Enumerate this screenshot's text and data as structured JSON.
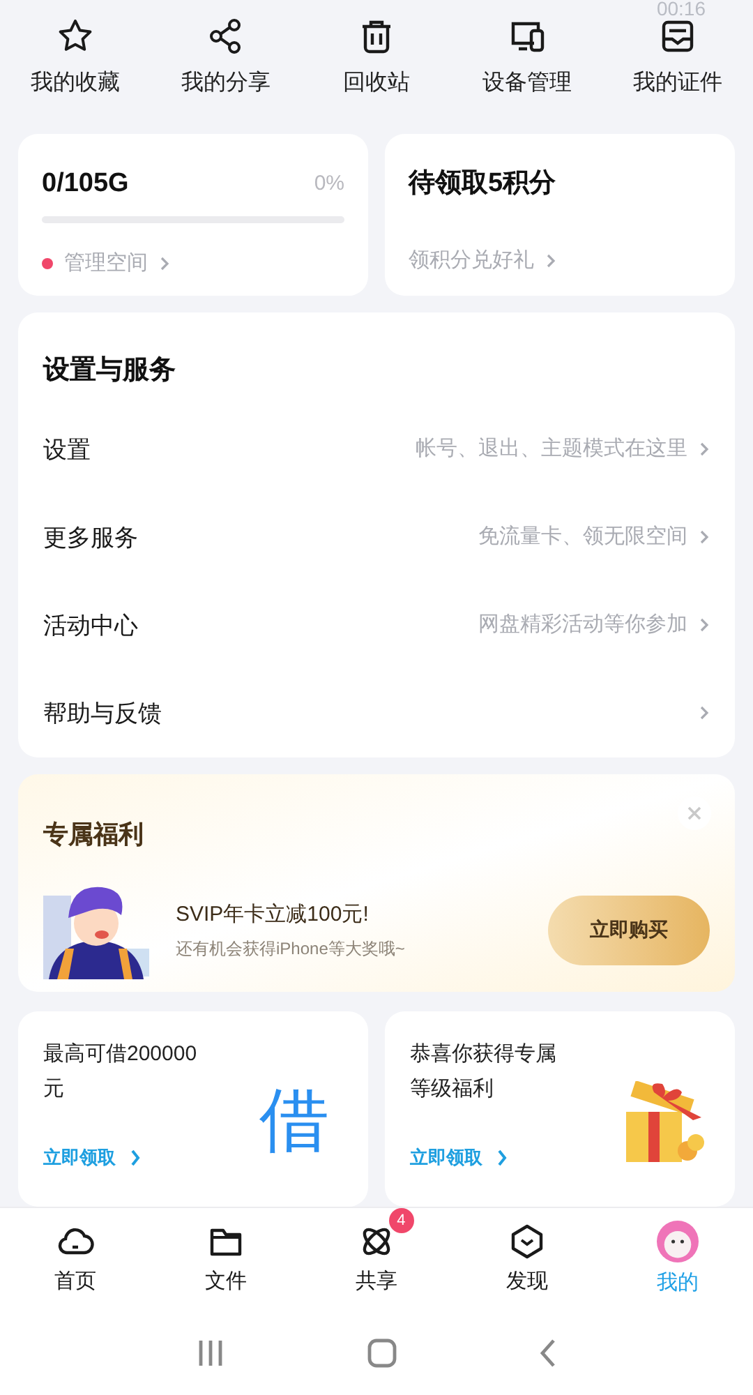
{
  "status_bar": {
    "time": "00:16"
  },
  "shortcuts": [
    {
      "kind": "star",
      "label": "我的收藏"
    },
    {
      "kind": "share",
      "label": "我的分享"
    },
    {
      "kind": "trash",
      "label": "回收站"
    },
    {
      "kind": "devices",
      "label": "设备管理"
    },
    {
      "kind": "id",
      "label": "我的证件"
    }
  ],
  "storage": {
    "usage": "0/105G",
    "percent": "0%",
    "level": 0,
    "link": "管理空间"
  },
  "points": {
    "title": "待领取5积分",
    "link": "领积分兑好礼"
  },
  "settings": {
    "title": "设置与服务",
    "rows": [
      {
        "label": "设置",
        "hint": "帐号、退出、主题模式在这里"
      },
      {
        "label": "更多服务",
        "hint": "免流量卡、领无限空间"
      },
      {
        "label": "活动中心",
        "hint": "网盘精彩活动等你参加"
      },
      {
        "label": "帮助与反馈"
      }
    ]
  },
  "promo": {
    "title": "专属福利",
    "headline": "SVIP年卡立减100元!",
    "subline": "还有机会获得iPhone等大奖哦~",
    "button": "立即购买"
  },
  "offers": [
    {
      "kind": "loan",
      "text": "最高可借200000元",
      "glyph": "借",
      "link": "立即领取"
    },
    {
      "kind": "gift",
      "text": "恭喜你获得专属等级福利",
      "link": "立即领取"
    }
  ],
  "nav": [
    {
      "kind": "cloud",
      "label": "首页",
      "selected": false
    },
    {
      "kind": "folder",
      "label": "文件",
      "selected": false
    },
    {
      "kind": "atom",
      "label": "共享",
      "selected": false,
      "badge": "4"
    },
    {
      "kind": "cube",
      "label": "发现",
      "selected": false
    },
    {
      "kind": "avatar",
      "label": "我的",
      "selected": true
    }
  ]
}
